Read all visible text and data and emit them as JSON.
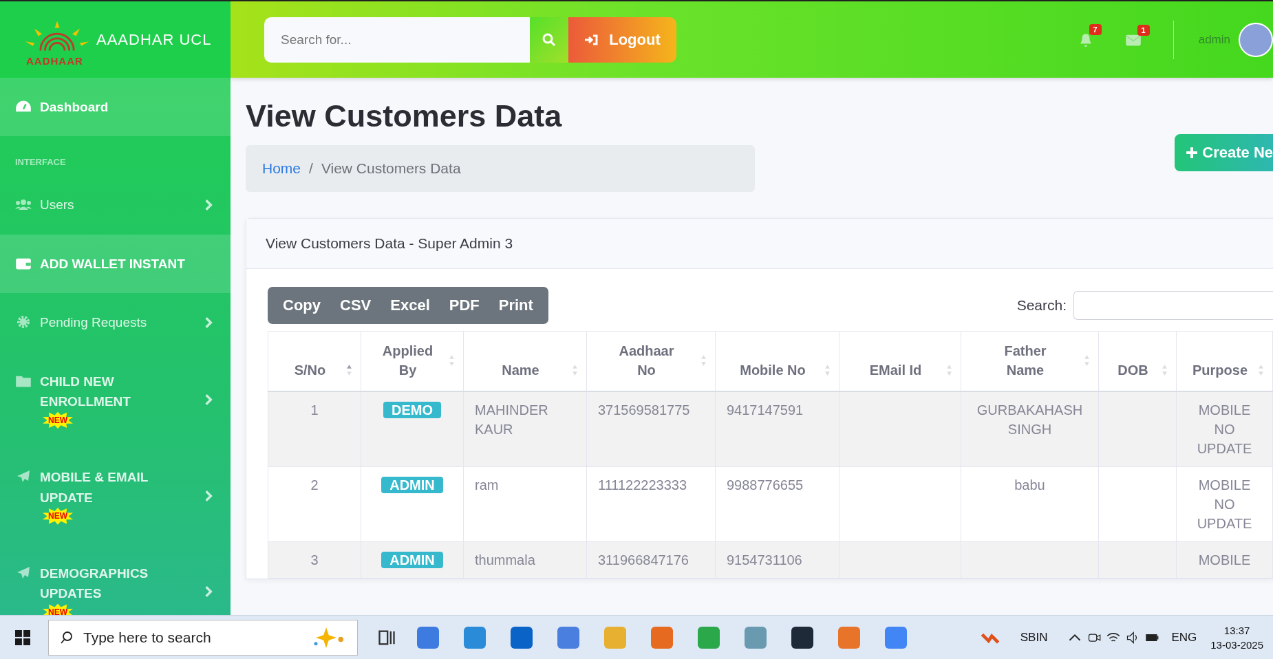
{
  "brand": {
    "logo_text": "AADHAAR",
    "name": "AAADHAR UCL"
  },
  "topbar": {
    "search": {
      "placeholder": "Search for..."
    },
    "logout": "Logout",
    "alerts_count": "7",
    "messages_count": "1",
    "user": "admin"
  },
  "sidebar": [
    {
      "kind": "link",
      "label": "Dashboard",
      "highlight": true,
      "bold": true,
      "has_children": false
    },
    {
      "kind": "heading",
      "label": "INTERFACE"
    },
    {
      "kind": "link",
      "label": "Users",
      "highlight": false,
      "bold": false,
      "has_children": true
    },
    {
      "kind": "link",
      "label": "ADD WALLET INSTANT",
      "highlight": true,
      "bold": true,
      "has_children": false
    },
    {
      "kind": "link",
      "label": "Pending Requests",
      "highlight": false,
      "bold": false,
      "has_children": true
    },
    {
      "kind": "link",
      "label": "CHILD NEW ENROLLMENT",
      "highlight": false,
      "bold": true,
      "has_children": true,
      "badge": "NEW"
    },
    {
      "kind": "link",
      "label": "MOBILE & EMAIL UPDATE",
      "highlight": false,
      "bold": true,
      "has_children": true,
      "badge": "NEW"
    },
    {
      "kind": "link",
      "label": "DEMOGRAPHICS UPDATES",
      "highlight": false,
      "bold": true,
      "has_children": true,
      "badge": "NEW"
    }
  ],
  "page": {
    "title": "View Customers Data",
    "create_button": "Create Ne",
    "breadcrumb_separator": "/",
    "breadcrumb": [
      {
        "label": "Home",
        "link": true
      },
      {
        "label": "View Customers Data",
        "link": false
      }
    ]
  },
  "card": {
    "title": "View Customers Data - Super Admin 3",
    "export_buttons": [
      "Copy",
      "CSV",
      "Excel",
      "PDF",
      "Print"
    ],
    "search_label": "Search:",
    "table": {
      "columns": [
        {
          "label": "S/No",
          "sorted": true
        },
        {
          "label": "Applied By",
          "sorted": false
        },
        {
          "label": "Name",
          "sorted": false
        },
        {
          "label": "Aadhaar No",
          "sorted": false
        },
        {
          "label": "Mobile No",
          "sorted": false
        },
        {
          "label": "EMail Id",
          "sorted": false
        },
        {
          "label": "Father Name",
          "sorted": false
        },
        {
          "label": "DOB",
          "sorted": false
        },
        {
          "label": "Purpose",
          "sorted": false
        }
      ],
      "rows": [
        [
          "1",
          "DEMO",
          "MAHINDER KAUR",
          "371569581775",
          "9417147591",
          "",
          "GURBAKAHASH SINGH",
          "",
          "MOBILE NO UPDATE"
        ],
        [
          "2",
          "ADMIN",
          "ram",
          "111122223333",
          "9988776655",
          "",
          "babu",
          "",
          "MOBILE NO UPDATE"
        ],
        [
          "3",
          "ADMIN",
          "thummala",
          "311966847176",
          "9154731106",
          "",
          "",
          "",
          "MOBILE"
        ]
      ]
    }
  },
  "taskbar": {
    "search_placeholder": "Type here to search",
    "stock": "SBIN",
    "language": "ENG",
    "time": "13:37",
    "date": "13-03-2025"
  }
}
